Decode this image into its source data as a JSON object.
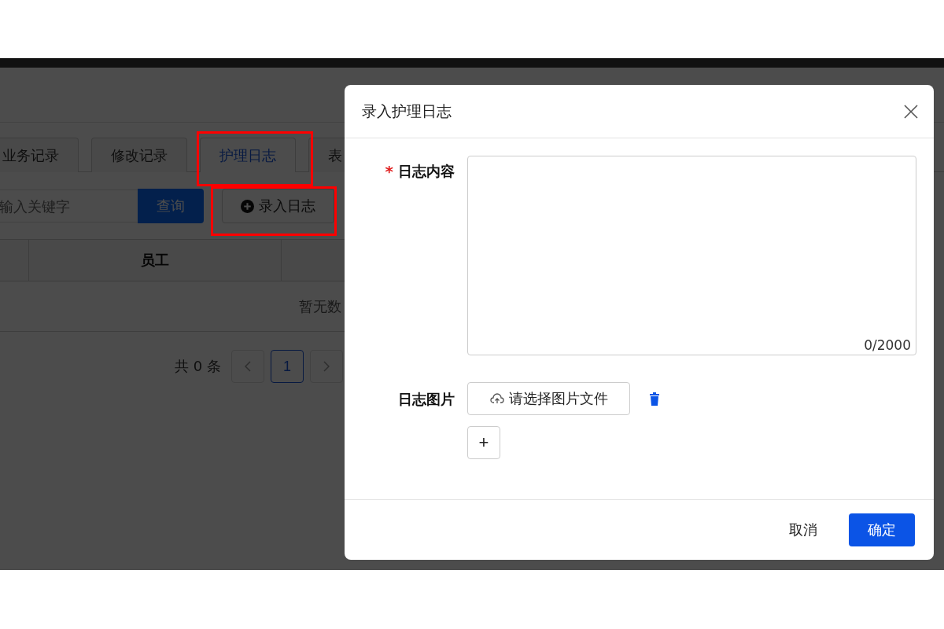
{
  "tabs": [
    {
      "label": "业务记录",
      "selected": false
    },
    {
      "label": "修改记录",
      "selected": false
    },
    {
      "label": "护理日志",
      "selected": true,
      "highlighted": true
    },
    {
      "label": "表",
      "selected": false
    }
  ],
  "toolbar": {
    "search": {
      "placeholder": "输入关键字"
    },
    "search_button": "查询",
    "add_button": {
      "label": "录入日志",
      "highlighted": true
    }
  },
  "table": {
    "columns": [
      {
        "label": "员工"
      }
    ],
    "empty_text": "暂无数"
  },
  "pagination": {
    "total": "共 0 条",
    "pages": [
      {
        "label": "1",
        "selected": true
      }
    ]
  },
  "dialog": {
    "title": "录入护理日志",
    "fields": [
      {
        "kind": "textarea",
        "label": "日志内容",
        "required_mark": "*",
        "counter": "0/2000"
      },
      {
        "kind": "upload",
        "label": "日志图片",
        "button": "请选择图片文件",
        "add": "+"
      }
    ],
    "buttons": [
      {
        "label": "取消",
        "primary": false
      },
      {
        "label": "确定",
        "primary": true
      }
    ]
  }
}
